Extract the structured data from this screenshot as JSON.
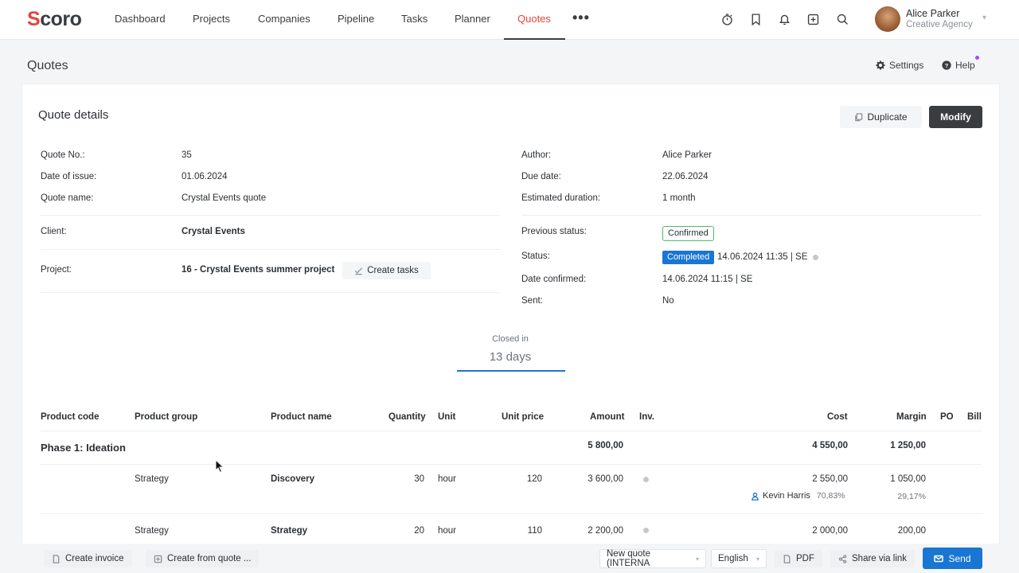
{
  "app": {
    "logo_text": "Scoro",
    "logo_first": "S",
    "logo_rest": "coro"
  },
  "nav": {
    "items": [
      {
        "label": "Dashboard"
      },
      {
        "label": "Projects"
      },
      {
        "label": "Companies"
      },
      {
        "label": "Pipeline"
      },
      {
        "label": "Tasks"
      },
      {
        "label": "Planner"
      },
      {
        "label": "Quotes",
        "active": true
      }
    ],
    "more": "•••",
    "tools": [
      "timer-icon",
      "bookmark-icon",
      "bell-icon",
      "add-icon",
      "search-icon"
    ]
  },
  "user": {
    "name": "Alice Parker",
    "role": "Creative Agency"
  },
  "page": {
    "title": "Quotes",
    "settings": "Settings",
    "help": "Help"
  },
  "card": {
    "title": "Quote details",
    "duplicate": "Duplicate",
    "modify": "Modify"
  },
  "details_left": {
    "quote_no_label": "Quote No.:",
    "quote_no": "35",
    "issue_label": "Date of issue:",
    "issue": "01.06.2024",
    "name_label": "Quote name:",
    "name": "Crystal Events quote",
    "client_label": "Client:",
    "client": "Crystal Events",
    "project_label": "Project:",
    "project": "16 - Crystal Events summer project",
    "create_tasks": "Create tasks"
  },
  "details_right": {
    "author_label": "Author:",
    "author": "Alice Parker",
    "due_label": "Due date:",
    "due": "22.06.2024",
    "duration_label": "Estimated duration:",
    "duration": "1 month",
    "prev_status_label": "Previous status:",
    "prev_status": "Confirmed",
    "status_label": "Status:",
    "status": "Completed",
    "status_meta": "14.06.2024 11:35 | SE",
    "confirmed_label": "Date confirmed:",
    "confirmed": "14.06.2024 11:15 | SE",
    "sent_label": "Sent:",
    "sent": "No"
  },
  "closed": {
    "label": "Closed in",
    "value": "13 days"
  },
  "table": {
    "headers": {
      "code": "Product code",
      "group": "Product group",
      "name": "Product name",
      "qty": "Quantity",
      "unit": "Unit",
      "price": "Unit price",
      "amount": "Amount",
      "inv": "Inv.",
      "cost": "Cost",
      "margin": "Margin",
      "po": "PO",
      "bill": "Bill"
    },
    "phase": {
      "name": "Phase 1: Ideation",
      "amount": "5 800,00",
      "cost": "4 550,00",
      "margin": "1 250,00"
    },
    "rows": [
      {
        "group": "Strategy",
        "name": "Discovery",
        "qty": "30",
        "unit": "hour",
        "price": "120",
        "amount": "3 600,00",
        "cost": "2 550,00",
        "margin": "1 050,00",
        "person": "Kevin Harris",
        "cost_pct": "70,83%",
        "margin_pct": "29,17%"
      },
      {
        "group": "Strategy",
        "name": "Strategy",
        "qty": "20",
        "unit": "hour",
        "price": "110",
        "amount": "2 200,00",
        "cost": "2 000,00",
        "margin": "200,00"
      }
    ]
  },
  "bottom": {
    "create_invoice": "Create invoice",
    "create_from_quote": "Create from quote ...",
    "template": "New quote (INTERNA",
    "language": "English",
    "pdf": "PDF",
    "share": "Share via link",
    "send": "Send"
  },
  "colors": {
    "accent": "#e2463a",
    "primary": "#1976d2",
    "dark": "#3a3d40"
  }
}
